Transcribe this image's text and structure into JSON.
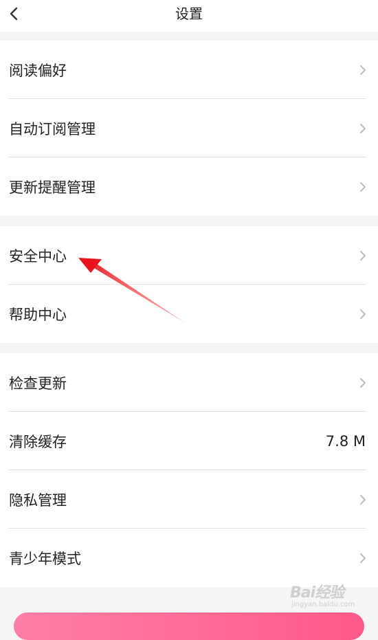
{
  "header": {
    "title": "设置"
  },
  "groups": [
    {
      "items": [
        {
          "label": "阅读偏好",
          "value": "",
          "chevron": true
        },
        {
          "label": "自动订阅管理",
          "value": "",
          "chevron": true
        },
        {
          "label": "更新提醒管理",
          "value": "",
          "chevron": true
        }
      ]
    },
    {
      "items": [
        {
          "label": "安全中心",
          "value": "",
          "chevron": true
        },
        {
          "label": "帮助中心",
          "value": "",
          "chevron": true
        }
      ]
    },
    {
      "items": [
        {
          "label": "检查更新",
          "value": "",
          "chevron": true
        },
        {
          "label": "清除缓存",
          "value": "7.8 M",
          "chevron": false
        },
        {
          "label": "隐私管理",
          "value": "",
          "chevron": true
        },
        {
          "label": "青少年模式",
          "value": "",
          "chevron": true
        }
      ]
    }
  ],
  "watermark": {
    "brand": "Bai经验",
    "url": "jingyan.baidu.com"
  },
  "colors": {
    "annotation_arrow": "#e8141c",
    "bottom_button": "#ff6b95"
  }
}
